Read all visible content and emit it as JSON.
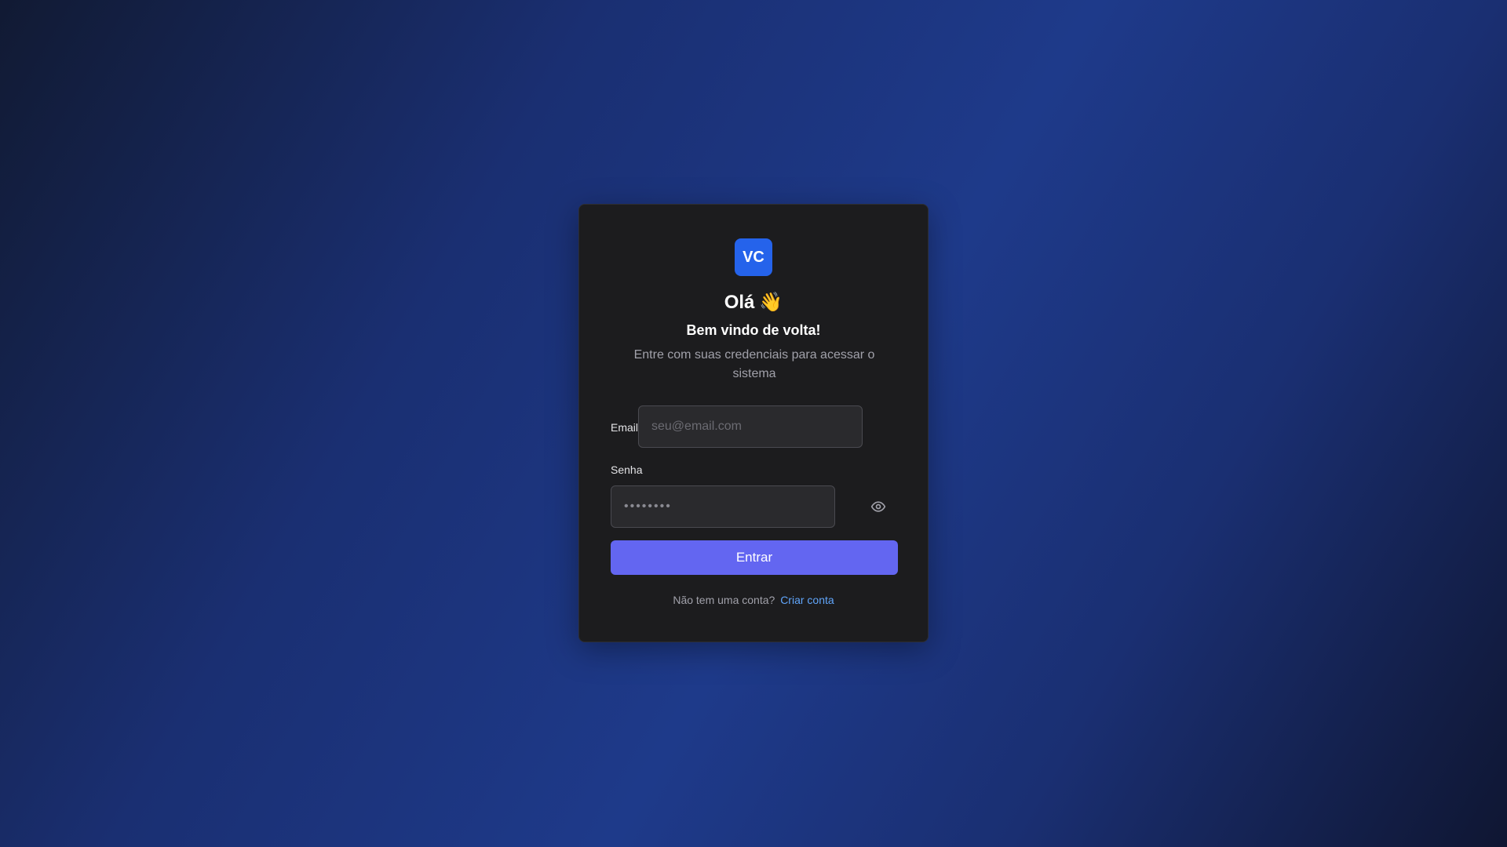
{
  "logo": {
    "text": "VC",
    "color": "#2563eb"
  },
  "header": {
    "title": "Olá",
    "title_emoji": "👋",
    "subtitle": "Bem vindo de volta!",
    "description": "Entre com suas credenciais para acessar o sistema"
  },
  "form": {
    "email_label": "Email",
    "email_placeholder": "seu@email.com",
    "email_value": "",
    "password_label": "Senha",
    "password_placeholder": "••••••••",
    "password_value": "",
    "toggle_icon": "eye-icon",
    "submit_label": "Entrar",
    "submit_color": "#6366f1"
  },
  "footer": {
    "prompt": "Não tem uma conta?",
    "link_label": "Criar conta",
    "link_color": "#60a5fa"
  }
}
